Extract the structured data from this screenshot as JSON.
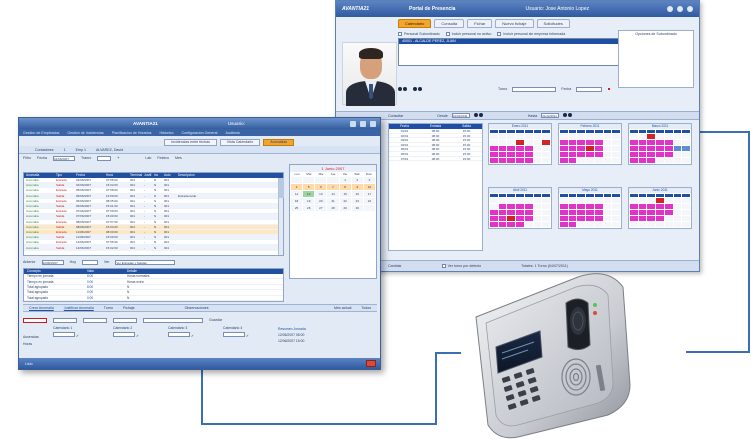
{
  "portal": {
    "brand": "AVANTIA21",
    "title": "Portal de Presencia",
    "user": "Usuario: Jose Antonio Lopez",
    "tabs": [
      "Calendario",
      "Consulta",
      "Fichar",
      "Nuevo fichaje",
      "Solicitudes"
    ],
    "active_tab": "Calendario",
    "checks": [
      "Personal Subordinado",
      "Incluir personal no activo",
      "Incluir personal sin empresa informada"
    ],
    "selected_row": "40001 - ALCALDE PEREZ, JUAN",
    "side_panel_label": "Opciones de Subordinado",
    "form_labels": [
      "Turno",
      "Fecha"
    ],
    "filter_labels": [
      "Consultar",
      "Desde",
      "Hasta"
    ],
    "from_date": "01/01/2011",
    "to_date": "31/12/2011",
    "calendar_months": [
      "Enero 2011",
      "Febrero 2011",
      "Marzo 2011",
      "Abril 2011",
      "Mayo 2011",
      "Junio 2011",
      "Julio 2011"
    ],
    "table_headers": [
      "Fecha",
      "Entrada",
      "Salida"
    ],
    "table_rows": [
      [
        "01/01",
        "08:00",
        "15:00"
      ],
      [
        "02/01",
        "08:00",
        "15:00"
      ],
      [
        "03/01",
        "08:00",
        "15:00"
      ],
      [
        "04/01",
        "08:00",
        "15:00"
      ],
      [
        "05/01",
        "08:00",
        "15:00"
      ],
      [
        "06/01",
        "08:00",
        "15:00"
      ],
      [
        "07/01",
        "08:00",
        "15:00"
      ]
    ],
    "status_left": "Cambiar",
    "status_check": "Ver turno por defecto",
    "status_right": "Totales: 1 Turno (04/07/2011)"
  },
  "app": {
    "title": "AVANTIA21",
    "title_right": "Usuario:",
    "menu": [
      "Gestion de Empleados",
      "Gestion de Incidencias",
      "Planificacion de Horarios",
      "Historico",
      "Configuracion General",
      "Auditoria"
    ],
    "subtabs": [
      "Incidencias entre fechas",
      "Vista Calendario",
      "Anomalias"
    ],
    "active_subtab": "Anomalias",
    "info": [
      "Contadores",
      "1",
      "Emp 1",
      "ALVAREZ, David"
    ],
    "toolbar": {
      "filter": "Filtro",
      "date_label": "Fecha",
      "date_value": "01/06/2007",
      "range_label": "Tramo",
      "check_a": "Lab",
      "check_b": "Festivo",
      "check_c": "Mes"
    },
    "table_headers": [
      "Anomalia",
      "Tipo",
      "Fecha",
      "Hora",
      "Terminal",
      "Justif",
      "Inc",
      "Auto",
      "Descripcion"
    ],
    "table_rows": [
      {
        "a": "Anomalia",
        "t": "Entrada",
        "f": "04/06/2007",
        "h": "07:55:00",
        "term": "001",
        "j": "-",
        "i": "N",
        "au": "001",
        "d": ""
      },
      {
        "a": "Anomalia",
        "t": "Salida",
        "f": "04/06/2007",
        "h": "15:02:00",
        "term": "001",
        "j": "-",
        "i": "N",
        "au": "001",
        "d": ""
      },
      {
        "a": "Anomalia",
        "t": "Entrada",
        "f": "05/06/2007",
        "h": "07:58:00",
        "term": "001",
        "j": "-",
        "i": "N",
        "au": "001",
        "d": ""
      },
      {
        "a": "Anomalia",
        "t": "Salida",
        "f": "05/06/2007",
        "h": "14:59:00",
        "term": "001",
        "j": "-",
        "i": "N",
        "au": "001",
        "d": "Entrada tarde"
      },
      {
        "a": "Anomalia",
        "t": "Entrada",
        "f": "06/06/2007",
        "h": "08:05:00",
        "term": "001",
        "j": "-",
        "i": "N",
        "au": "001",
        "d": ""
      },
      {
        "a": "Anomalia",
        "t": "Salida",
        "f": "06/06/2007",
        "h": "15:01:00",
        "term": "001",
        "j": "-",
        "i": "N",
        "au": "001",
        "d": ""
      },
      {
        "a": "Anomalia",
        "t": "Entrada",
        "f": "07/06/2007",
        "h": "07:59:00",
        "term": "001",
        "j": "-",
        "i": "N",
        "au": "001",
        "d": ""
      },
      {
        "a": "Anomalia",
        "t": "Salida",
        "f": "07/06/2007",
        "h": "15:00:00",
        "term": "001",
        "j": "-",
        "i": "N",
        "au": "001",
        "d": ""
      },
      {
        "a": "Anomalia",
        "t": "Entrada",
        "f": "08/06/2007",
        "h": "07:57:00",
        "term": "001",
        "j": "-",
        "i": "N",
        "au": "001",
        "d": ""
      },
      {
        "a": "Anomalia",
        "t": "Salida",
        "f": "08/06/2007",
        "h": "15:04:00",
        "term": "001",
        "j": "-",
        "i": "N",
        "au": "001",
        "d": ""
      },
      {
        "a": "Anomalia",
        "t": "Entrada",
        "f": "11/06/2007",
        "h": "08:00:00",
        "term": "001",
        "j": "-",
        "i": "N",
        "au": "001",
        "d": ""
      },
      {
        "a": "Anomalia",
        "t": "Salida",
        "f": "11/06/2007",
        "h": "15:00:00",
        "term": "001",
        "j": "-",
        "i": "N",
        "au": "001",
        "d": ""
      },
      {
        "a": "Anomalia",
        "t": "Entrada",
        "f": "12/06/2007",
        "h": "07:56:00",
        "term": "001",
        "j": "-",
        "i": "N",
        "au": "001",
        "d": ""
      },
      {
        "a": "Anomalia",
        "t": "Salida",
        "f": "12/06/2007",
        "h": "15:02:00",
        "term": "001",
        "j": "-",
        "i": "N",
        "au": "001",
        "d": ""
      }
    ],
    "calendar": {
      "month": "1 Junio 2007",
      "days": [
        "Lun",
        "Mar",
        "Mie",
        "Jue",
        "Vie",
        "Sab",
        "Dom"
      ],
      "cells": [
        "",
        "",
        "",
        "",
        "1",
        "2",
        "3",
        "4",
        "5",
        "6",
        "7",
        "8",
        "9",
        "10",
        "11",
        "12",
        "13",
        "14",
        "15",
        "16",
        "17",
        "18",
        "19",
        "20",
        "21",
        "22",
        "23",
        "24",
        "25",
        "26",
        "27",
        "28",
        "29",
        "30",
        ""
      ]
    },
    "nav": {
      "label_a": "Anterior",
      "date_value": "12/06/2007",
      "label_b": "Hoy",
      "label_c": "Ver",
      "combo": "Ver Entradas y Salidas"
    },
    "summary_headers": [
      "Concepto",
      "Valor",
      "Detalle"
    ],
    "summary_rows": [
      {
        "c": "Tiempo en jornada",
        "v": "8:00",
        "d": "Horas normales"
      },
      {
        "c": "Tiempo en jornada",
        "v": "0:00",
        "d": "Horas extra"
      },
      {
        "c": "Total agrupado",
        "v": "8:00",
        "d": "N"
      },
      {
        "c": "Total agrupado",
        "v": "0:00",
        "d": "N"
      },
      {
        "c": "Total agrupado",
        "v": "0:00",
        "d": "N"
      }
    ],
    "links": [
      "Crear Anomalia",
      "Justificar Anomalia",
      "Turno",
      "Fichaje",
      "Observaciones"
    ],
    "links_checks": [
      "Mes actual",
      "Todos"
    ],
    "inputs_label": "Guardar",
    "cal_groups": [
      "Calendario 1",
      "Calendario 2",
      "Calendario 3",
      "Calendario 4"
    ],
    "cal_row_labels": [
      "Ausencias",
      "Horas"
    ],
    "cal_lines": [
      "Resumen Jornada",
      "12/06/2007 08:00",
      "12/06/2007 15:00"
    ],
    "status": "Listo"
  },
  "device": {
    "brand": "",
    "screen_text": ""
  },
  "colors": {
    "accent_orange": "#f1a531",
    "header_blue": "#2250a0",
    "connector_blue": "#3a6fb6",
    "magenta_mark": "#e233c9",
    "red_mark": "#d32424"
  }
}
